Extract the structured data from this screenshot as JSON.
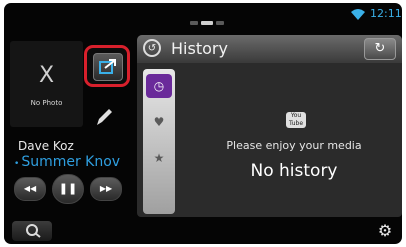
{
  "status": {
    "time": "12:11",
    "wifi_icon": "wifi-icon"
  },
  "left_panel": {
    "photo_placeholder_mark": "X",
    "photo_placeholder_text": "No Photo",
    "artist": "Dave Koz",
    "track": "Summer Knov",
    "transport_icons": [
      "previous-icon",
      "pause-icon",
      "next-icon"
    ]
  },
  "history": {
    "title": "History",
    "tabs": [
      "history-clock-icon",
      "favorite-heart-icon",
      "star-icon"
    ],
    "youtube_logo_text": "You Tube",
    "message": "Please enjoy your media",
    "empty_text": "No history"
  },
  "colors": {
    "accent_blue": "#2f9fe0",
    "highlight_red": "#d8202c",
    "tab_active_purple": "#6a2a9a"
  }
}
